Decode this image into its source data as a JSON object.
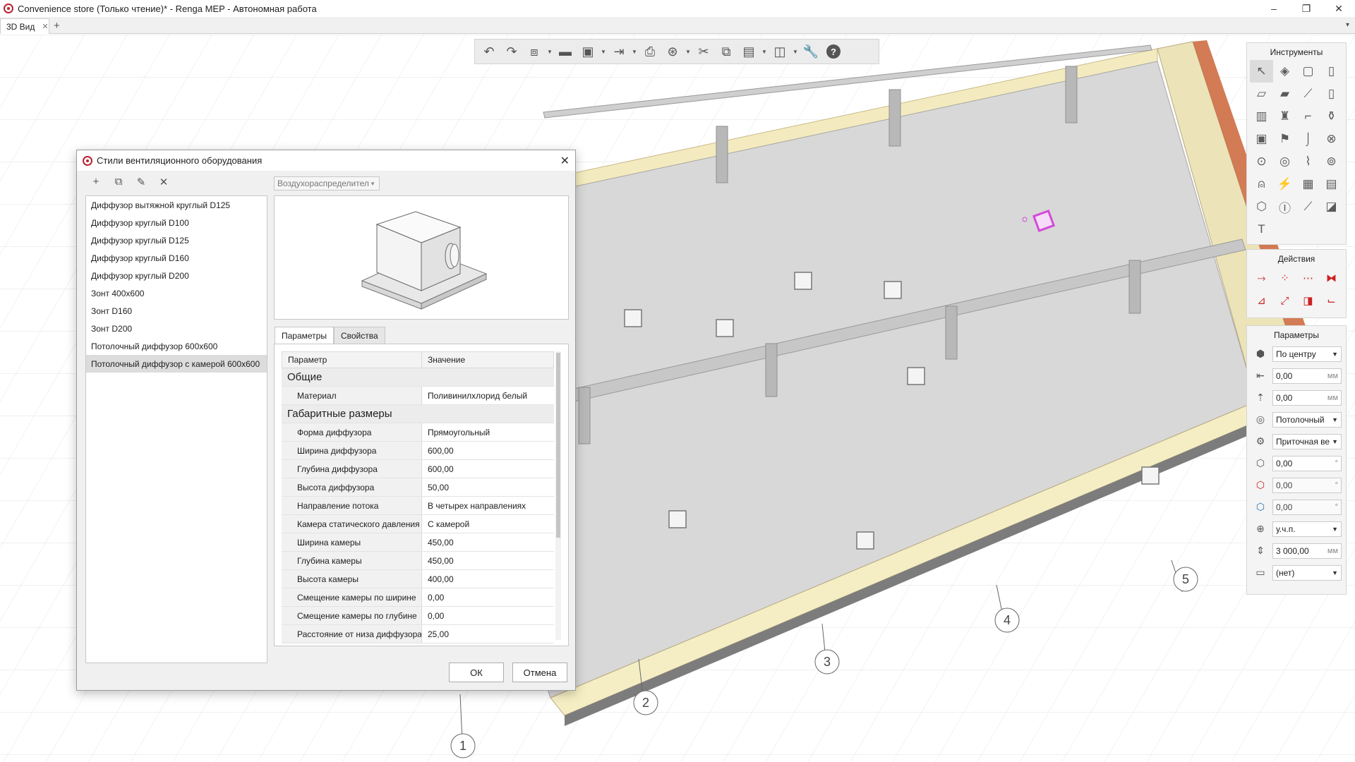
{
  "window": {
    "title": "Convenience store (Только чтение)* - Renga MEP - Автономная работа",
    "minimize": "–",
    "restore": "❐",
    "close": "✕"
  },
  "tabs": [
    {
      "label": "3D Вид",
      "close": "✕"
    }
  ],
  "tab_add": "+",
  "tab_menu": "▾",
  "toolbar": {
    "icons": [
      "undo-icon",
      "redo-icon",
      "view-cube-icon",
      "open-icon",
      "save-icon",
      "export-icon",
      "print-icon",
      "navigation-icon",
      "cut-icon",
      "copy-icon",
      "paste-icon",
      "layers-icon",
      "settings-icon",
      "help-icon"
    ]
  },
  "tools_panel": {
    "title": "Инструменты",
    "text_tool": "T"
  },
  "actions_panel": {
    "title": "Действия"
  },
  "params_panel": {
    "title": "Параметры",
    "rows": [
      {
        "value": "По центру",
        "kind": "dropdown"
      },
      {
        "value": "0,00",
        "unit": "мм"
      },
      {
        "value": "0,00",
        "unit": "мм"
      },
      {
        "value": "Потолочный",
        "kind": "dropdown"
      },
      {
        "value": "Приточная ве",
        "kind": "dropdown"
      },
      {
        "value": "0,00",
        "unit": "°"
      },
      {
        "value": "0,00",
        "unit": "°"
      },
      {
        "value": "0,00",
        "unit": "°"
      },
      {
        "value": "у.ч.п.",
        "kind": "dropdown"
      },
      {
        "value": "3 000,00",
        "unit": "мм"
      },
      {
        "value": "(нет)",
        "kind": "dropdown"
      }
    ]
  },
  "dialog": {
    "title": "Стили вентиляционного оборудования",
    "close": "✕",
    "list_toolbar": {
      "add": "+",
      "copy": "⧉",
      "edit": "✎",
      "delete": "✕"
    },
    "type_select": "Воздухораспределител",
    "styles": [
      "Диффузор вытяжной круглый D125",
      "Диффузор круглый D100",
      "Диффузор круглый D125",
      "Диффузор круглый D160",
      "Диффузор круглый D200",
      "Зонт 400x600",
      "Зонт D160",
      "Зонт D200",
      "Потолочный диффузор 600x600",
      "Потолочный диффузор с камерой 600x600"
    ],
    "selected_index": 9,
    "tabs": [
      "Параметры",
      "Свойства"
    ],
    "table": {
      "col_param": "Параметр",
      "col_value": "Значение",
      "groups": [
        {
          "name": "Общие",
          "rows": [
            {
              "name": "Материал",
              "value": "Поливинилхлорид белый"
            }
          ]
        },
        {
          "name": "Габаритные размеры",
          "rows": [
            {
              "name": "Форма диффузора",
              "value": "Прямоугольный"
            },
            {
              "name": "Ширина диффузора",
              "value": "600,00"
            },
            {
              "name": "Глубина диффузора",
              "value": "600,00"
            },
            {
              "name": "Высота диффузора",
              "value": "50,00"
            },
            {
              "name": "Направление потока",
              "value": "В четырех направлениях"
            },
            {
              "name": "Камера статического давления",
              "value": "С камерой"
            },
            {
              "name": "Ширина камеры",
              "value": "450,00"
            },
            {
              "name": "Глубина камеры",
              "value": "450,00"
            },
            {
              "name": "Высота камеры",
              "value": "400,00"
            },
            {
              "name": "Смещение камеры по ширине",
              "value": "0,00"
            },
            {
              "name": "Смещение камеры по глубине",
              "value": "0,00"
            },
            {
              "name": "Расстояние от низа диффузора д",
              "value": "25,00"
            }
          ]
        }
      ]
    },
    "ok": "ОК",
    "cancel": "Отмена"
  },
  "grid_axes": [
    "1",
    "2",
    "3",
    "4",
    "5"
  ],
  "colors": {
    "accent": "#b8232f",
    "floor": "#d9d9d9",
    "wall": "#f5eec4",
    "selection": "#d44bd9"
  }
}
